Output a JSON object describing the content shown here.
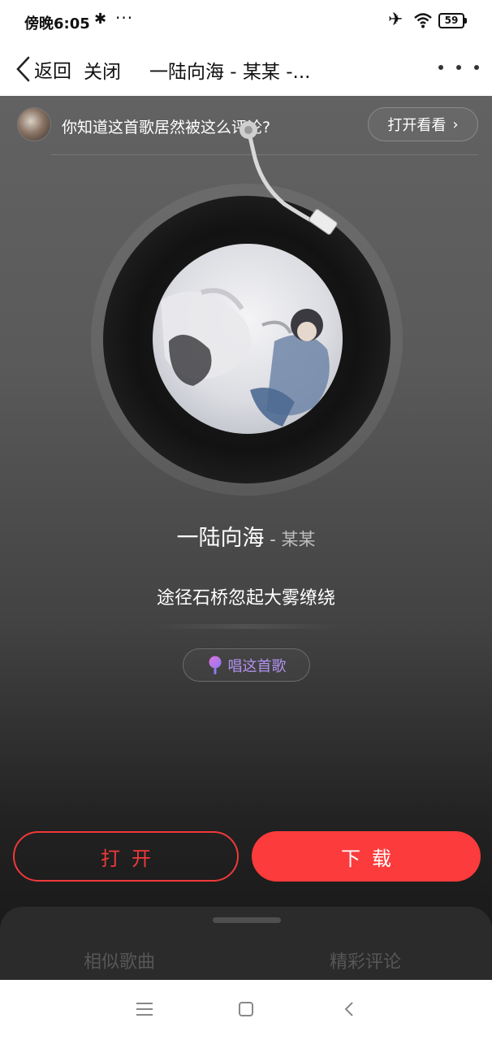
{
  "status_bar": {
    "time": "傍晚6:05",
    "bluetooth_icon": "bluetooth-icon",
    "more_icon": "dots-icon",
    "airplane_icon": "airplane-icon",
    "wifi_icon": "wifi-icon",
    "battery": "59"
  },
  "nav": {
    "back_label": "返回",
    "close_label": "关闭",
    "title": "一陆向海 - 某某 -...",
    "more_icon": "more-dots-icon"
  },
  "promo": {
    "text": "你知道这首歌居然被这么评论?",
    "button_label": "打开看看",
    "button_chevron": "›"
  },
  "song": {
    "title": "一陆向海",
    "separator": " - ",
    "artist": "某某",
    "lyric": "途径石桥忽起大雾缭绕"
  },
  "sing": {
    "label": "唱这首歌",
    "icon": "microphone-icon"
  },
  "actions": {
    "open_label": "打开",
    "download_label": "下载"
  },
  "sheet": {
    "tabs": [
      "相似歌曲",
      "精彩评论"
    ]
  },
  "colors": {
    "accent_red": "#fb3b3c",
    "sing_purple": "#b292ef"
  }
}
